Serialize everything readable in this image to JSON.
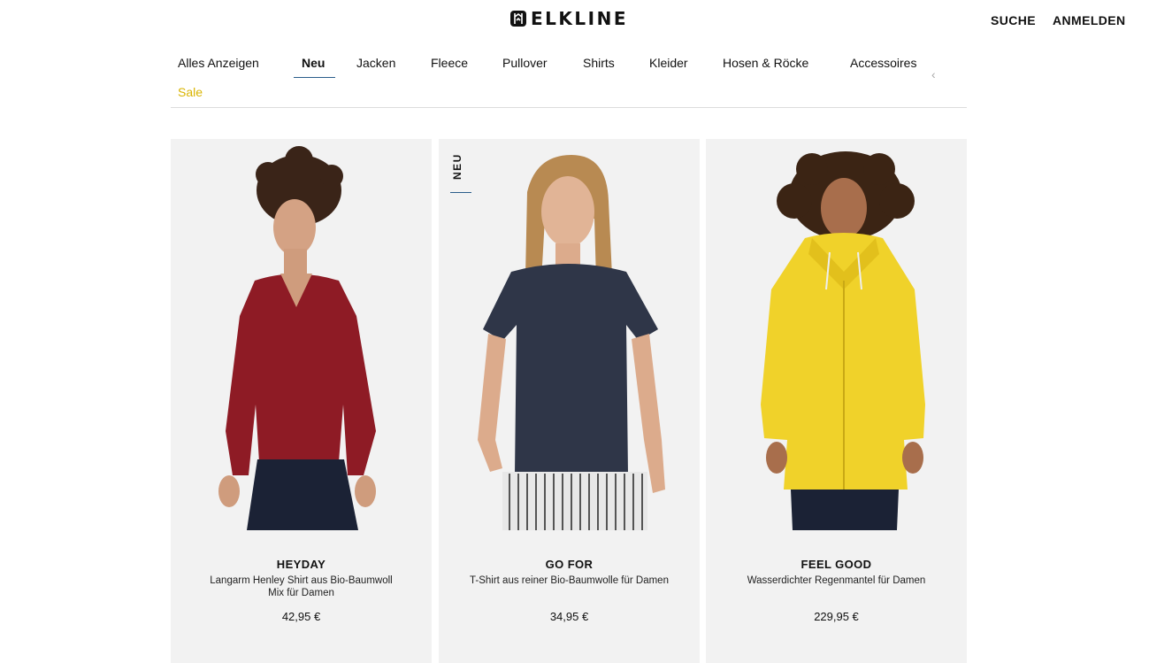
{
  "header": {
    "logo_text": "ELKLINE",
    "logo_icon": "elk-antler-logo-icon",
    "search_label": "SUCHE",
    "login_label": "ANMELDEN"
  },
  "nav": {
    "items": [
      {
        "label": "Alles Anzeigen"
      },
      {
        "label": "Neu",
        "active": true
      },
      {
        "label": "Jacken"
      },
      {
        "label": "Fleece"
      },
      {
        "label": "Pullover"
      },
      {
        "label": "Shirts"
      },
      {
        "label": "Kleider"
      },
      {
        "label": "Hosen & Röcke"
      },
      {
        "label": "Accessoires"
      }
    ],
    "sale_label": "Sale",
    "prev_icon": "‹",
    "accent_color": "#2a5d8a",
    "sale_color": "#d9b400"
  },
  "products": [
    {
      "brand": "HEYDAY",
      "description": "Langarm Henley Shirt aus Bio-Baumwoll Mix für Damen",
      "price": "42,95 €",
      "garment_color": "#8e1b25"
    },
    {
      "badge": "NEU",
      "brand": "GO FOR",
      "description": "T-Shirt aus reiner Bio-Baumwolle für Damen",
      "price": "34,95 €",
      "garment_color": "#2f3648"
    },
    {
      "brand": "FEEL GOOD",
      "description": "Wasserdichter Regenmantel für Damen",
      "price": "229,95 €",
      "garment_color": "#f0d22a"
    }
  ]
}
